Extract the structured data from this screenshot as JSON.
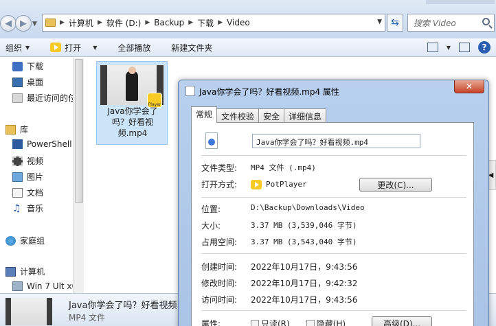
{
  "address": {
    "crumbs": [
      "计算机",
      "软件 (D:)",
      "Backup",
      "下载",
      "Video"
    ],
    "search_placeholder": "搜索 Video"
  },
  "toolbar": {
    "organize": "组织",
    "open": "打开",
    "play_all": "全部播放",
    "new_folder": "新建文件夹"
  },
  "nav": {
    "items": [
      "下载",
      "桌面",
      "最近访问的位",
      "库",
      "PowerShell",
      "视频",
      "图片",
      "文档",
      "音乐",
      "家庭组",
      "计算机",
      "Win 7 Ult x6"
    ]
  },
  "file": {
    "name": "Java你学会了吗？好看视频.mp4",
    "badge": "Player"
  },
  "details": {
    "name": "Java你学会了吗？好看视频.",
    "type": "MP4 文件"
  },
  "dialog": {
    "title": "Java你学会了吗？好看视频.mp4 属性",
    "close": "✕",
    "tabs": [
      "常规",
      "文件校验",
      "安全",
      "详细信息"
    ],
    "filename": "Java你学会了吗？好看视频.mp4",
    "type_label": "文件类型:",
    "type_value": "MP4 文件 (.mp4)",
    "open_label": "打开方式:",
    "open_value": "PotPlayer",
    "change_button": "更改(C)...",
    "location_label": "位置:",
    "location_value": "D:\\Backup\\Downloads\\Video",
    "size_label": "大小:",
    "size_value": "3.37 MB (3,539,046 字节)",
    "disk_label": "占用空间:",
    "disk_value": "3.37 MB (3,543,040 字节)",
    "created_label": "创建时间:",
    "created_value": "2022年10月17日，9:43:56",
    "modified_label": "修改时间:",
    "modified_value": "2022年10月17日，9:42:32",
    "accessed_label": "访问时间:",
    "accessed_value": "2022年10月17日，9:43:56",
    "attr_label": "属性:",
    "readonly": "只读(R)",
    "hidden": "隐藏(H)",
    "advanced": "高级(D)..."
  }
}
